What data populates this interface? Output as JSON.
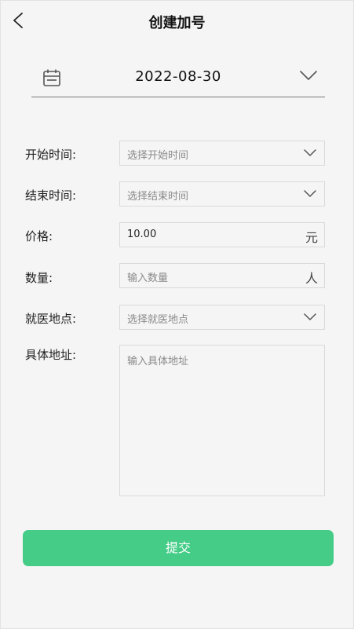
{
  "header": {
    "title": "创建加号"
  },
  "date": {
    "value": "2022-08-30"
  },
  "form": {
    "start_time": {
      "label": "开始时间:",
      "placeholder": "选择开始时间"
    },
    "end_time": {
      "label": "结束时间:",
      "placeholder": "选择结束时间"
    },
    "price": {
      "label": "价格:",
      "value": "10.00",
      "unit": "元"
    },
    "quantity": {
      "label": "数量:",
      "placeholder": "输入数量",
      "unit": "人"
    },
    "location": {
      "label": "就医地点:",
      "placeholder": "选择就医地点"
    },
    "address": {
      "label": "具体地址:",
      "placeholder": "输入具体地址"
    }
  },
  "submit": {
    "label": "提交"
  },
  "colors": {
    "accent": "#45cd88",
    "background": "#f5f5f5"
  },
  "icons": [
    "back-arrow-icon",
    "calendar-icon",
    "chevron-down-icon"
  ]
}
